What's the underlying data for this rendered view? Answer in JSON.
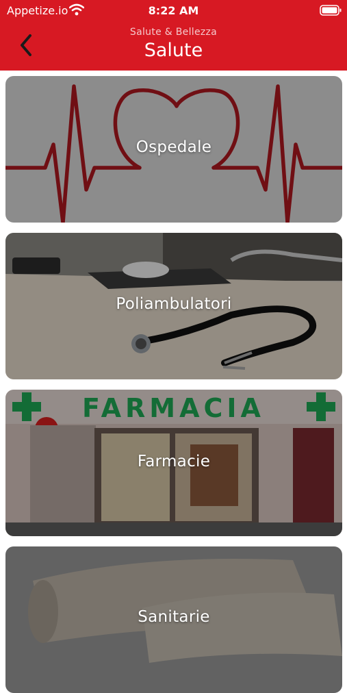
{
  "status_bar": {
    "carrier": "Appetize.io",
    "time": "8:22 AM",
    "wifi_icon": "wifi-icon",
    "battery_icon": "battery-icon"
  },
  "header": {
    "background_color": "#d71923",
    "subtitle": "Salute & Bellezza",
    "title": "Salute",
    "back_icon": "chevron-left-icon"
  },
  "categories": [
    {
      "label": "Ospedale",
      "image": "heartbeat-heart-image"
    },
    {
      "label": "Poliambulatori",
      "image": "stethoscope-desk-image"
    },
    {
      "label": "Farmacie",
      "image": "pharmacy-storefront-image"
    },
    {
      "label": "Sanitarie",
      "image": "bandage-rolls-image"
    }
  ]
}
